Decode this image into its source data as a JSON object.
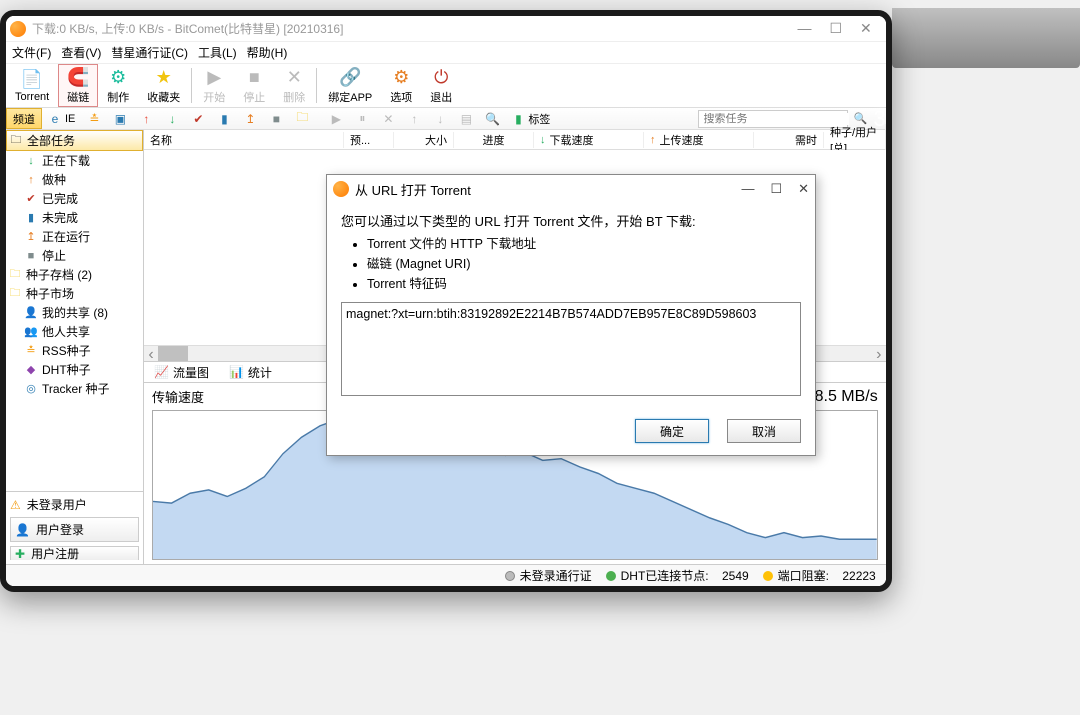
{
  "window": {
    "title": "下载:0 KB/s, 上传:0 KB/s - BitComet(比特彗星) [20210316]"
  },
  "menu": {
    "file": "文件(F)",
    "view": "查看(V)",
    "passport": "彗星通行证(C)",
    "tools": "工具(L)",
    "help": "帮助(H)"
  },
  "toolbar": {
    "torrent": "Torrent",
    "magnet": "磁链",
    "make": "制作",
    "fav": "收藏夹",
    "start": "开始",
    "stop": "停止",
    "delete": "删除",
    "bindapp": "绑定APP",
    "options": "选项",
    "exit": "退出"
  },
  "smallbar": {
    "channel": "频道",
    "ie": "IE",
    "tag_label": "标签",
    "search_ph": "搜索任务"
  },
  "tree": {
    "all": "全部任务",
    "downloading": "正在下载",
    "seeding": "做种",
    "completed": "已完成",
    "incomplete": "未完成",
    "running": "正在运行",
    "stopped": "停止",
    "archive": "种子存档 (2)",
    "market": "种子市场",
    "myshare": "我的共享 (8)",
    "othershare": "他人共享",
    "rss": "RSS种子",
    "dht": "DHT种子",
    "tracker": "Tracker 种子"
  },
  "login": {
    "not_logged": "未登录用户",
    "login_btn": "用户登录",
    "register_btn": "用户注册"
  },
  "columns": {
    "name": "名称",
    "preview": "预...",
    "size": "大小",
    "progress": "进度",
    "dlspeed": "下载速度",
    "ulspeed": "上传速度",
    "eta": "需时",
    "seedpeer": "种子/用户 [总]"
  },
  "tabs2": {
    "flow": "流量图",
    "stats": "统计"
  },
  "speed": {
    "title": "传输速度",
    "value": "8.5 MB/s"
  },
  "status": {
    "passport": "未登录通行证",
    "dht_label": "DHT已连接节点:",
    "dht_val": "2549",
    "port_label": "端口阻塞:",
    "port_val": "22223"
  },
  "dialog": {
    "title": "从 URL 打开 Torrent",
    "intro": "您可以通过以下类型的 URL 打开 Torrent 文件，开始 BT 下载:",
    "li1": "Torrent 文件的 HTTP 下载地址",
    "li2": "磁链 (Magnet URI)",
    "li3": "Torrent 特征码",
    "value": "magnet:?xt=urn:btih:83192892E2214B7B574ADD7EB957E8C89D598603",
    "ok": "确定",
    "cancel": "取消"
  },
  "chart_data": {
    "type": "area",
    "title": "传输速度",
    "ylabel": "MB/s",
    "ylim": [
      0,
      9
    ],
    "x": [
      0,
      1,
      2,
      3,
      4,
      5,
      6,
      7,
      8,
      9,
      10,
      11,
      12,
      13,
      14,
      15,
      16,
      17,
      18,
      19,
      20,
      21,
      22,
      23,
      24,
      25,
      26,
      27,
      28,
      29,
      30,
      31,
      32,
      33,
      34,
      35,
      36,
      37,
      38,
      39
    ],
    "values": [
      3.5,
      3.4,
      4.0,
      4.2,
      3.8,
      4.3,
      5.0,
      6.4,
      7.4,
      8.1,
      8.5,
      8.2,
      8.4,
      7.6,
      7.4,
      7.0,
      7.3,
      7.1,
      6.6,
      6.3,
      6.5,
      6.0,
      6.1,
      5.6,
      5.2,
      4.6,
      4.3,
      4.0,
      3.5,
      3.0,
      2.5,
      2.1,
      1.6,
      1.3,
      1.6,
      1.3,
      1.4,
      1.2,
      1.2,
      1.2
    ]
  }
}
